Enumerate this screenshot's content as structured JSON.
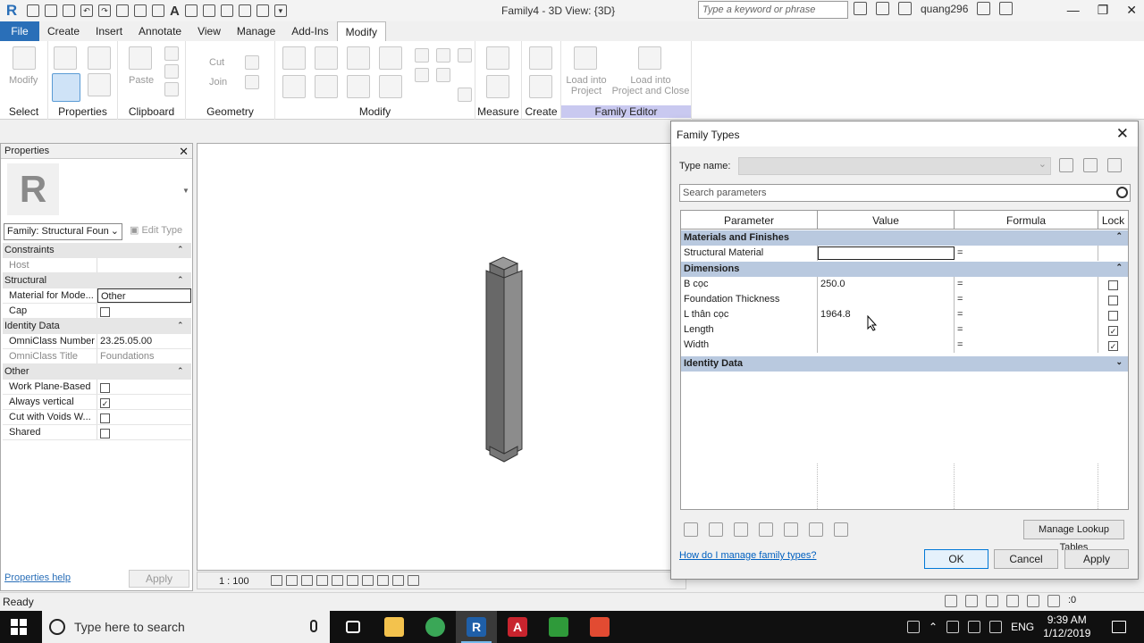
{
  "app": {
    "window_title": "Family4 - 3D View: {3D}",
    "search_placeholder": "Type a keyword or phrase",
    "user": "quang296",
    "logo": "R"
  },
  "ribbon": {
    "tabs": [
      "File",
      "Create",
      "Insert",
      "Annotate",
      "View",
      "Manage",
      "Add-Ins",
      "Modify"
    ],
    "active_tab": "Modify",
    "modify_label": "Modify",
    "paste_label": "Paste",
    "cut_label": "Cut",
    "join_label": "Join",
    "load_into_project": "Load into\nProject",
    "load_into_project_close": "Load into\nProject and Close",
    "groups": {
      "select": "Select",
      "properties": "Properties",
      "clipboard": "Clipboard",
      "geometry": "Geometry",
      "modify": "Modify",
      "measure": "Measure",
      "create": "Create",
      "family_editor": "Family Editor"
    }
  },
  "properties": {
    "title": "Properties",
    "family_selector": "Family: Structural Foun",
    "edit_type": "Edit Type",
    "categories": {
      "constraints": "Constraints",
      "structural": "Structural",
      "identity": "Identity Data",
      "other": "Other"
    },
    "rows": {
      "host": {
        "name": "Host",
        "value": ""
      },
      "material": {
        "name": "Material for Mode...",
        "value": "Other"
      },
      "cap": {
        "name": "Cap",
        "checked": false
      },
      "omniclass_number": {
        "name": "OmniClass Number",
        "value": "23.25.05.00"
      },
      "omniclass_title": {
        "name": "OmniClass Title",
        "value": "Foundations"
      },
      "work_plane": {
        "name": "Work Plane-Based",
        "checked": false
      },
      "always_vertical": {
        "name": "Always vertical",
        "checked": true
      },
      "cut_voids": {
        "name": "Cut with Voids W...",
        "checked": false
      },
      "shared": {
        "name": "Shared",
        "checked": false
      }
    },
    "help_link": "Properties help",
    "apply": "Apply"
  },
  "view": {
    "scale": "1 : 100"
  },
  "status": {
    "text": "Ready",
    "filter_count": ":0"
  },
  "dialog": {
    "title": "Family Types",
    "type_name_label": "Type name:",
    "search_placeholder": "Search parameters",
    "columns": [
      "Parameter",
      "Value",
      "Formula",
      "Lock"
    ],
    "groups": {
      "materials": "Materials and Finishes",
      "dimensions": "Dimensions",
      "identity": "Identity Data"
    },
    "params": {
      "structural_material": {
        "name": "Structural Material",
        "value": "",
        "formula": "="
      },
      "b_coc": {
        "name": "B cọc",
        "value": "250.0",
        "formula": "=",
        "lock": false
      },
      "foundation_thickness": {
        "name": "Foundation Thickness",
        "value": "",
        "formula": "=",
        "lock": false
      },
      "l_than_coc": {
        "name": "L thân cọc",
        "value": "1964.8",
        "formula": "=",
        "lock": false
      },
      "length": {
        "name": "Length",
        "value": "",
        "formula": "=",
        "lock": true
      },
      "width": {
        "name": "Width",
        "value": "",
        "formula": "=",
        "lock": true
      }
    },
    "manage_lookup": "Manage Lookup Tables",
    "help_link": "How do I manage family types?",
    "ok": "OK",
    "cancel": "Cancel",
    "apply": "Apply"
  },
  "taskbar": {
    "search_text": "Type here to search",
    "time": "9:39 AM",
    "date": "1/12/2019",
    "lang": "ENG"
  }
}
